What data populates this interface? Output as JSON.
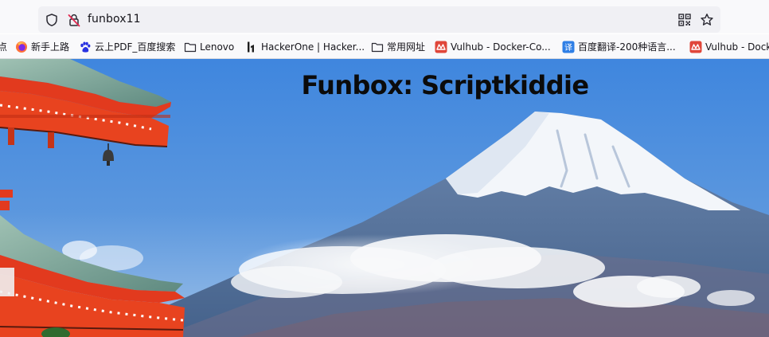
{
  "browser": {
    "address_bar": {
      "url": "funbox11",
      "icons": [
        "shield-icon",
        "insecure-connection-icon",
        "qr-code-icon",
        "bookmark-star-icon"
      ]
    },
    "bookmarks": [
      {
        "label": "点",
        "icon": "none"
      },
      {
        "label": "新手上路",
        "icon": "firefox-icon"
      },
      {
        "label": "云上PDF_百度搜索",
        "icon": "baidu-paw-icon"
      },
      {
        "label": "Lenovo",
        "icon": "folder-icon"
      },
      {
        "label": "HackerOne | Hacker...",
        "icon": "hackerone-icon"
      },
      {
        "label": "常用网址",
        "icon": "folder-icon"
      },
      {
        "label": "Vulhub - Docker-Co...",
        "icon": "vulhub-icon"
      },
      {
        "label": "百度翻译-200种语言...",
        "icon": "translate-icon"
      },
      {
        "label": "Vulhub - Dock",
        "icon": "vulhub-icon"
      }
    ]
  },
  "page": {
    "title": "Funbox: Scriptkiddie",
    "hero_image": "mount-fuji-pagoda-photo"
  },
  "colors": {
    "sky": "#5b97de",
    "pagoda_red": "#e23a1e",
    "pagoda_roof": "#7fa69a",
    "snow": "#f4f7fb",
    "mountain": "#5f7a9e",
    "title": "#0b0b0b",
    "vulhub_red": "#e0463a",
    "translate_blue": "#2f7fe6"
  }
}
